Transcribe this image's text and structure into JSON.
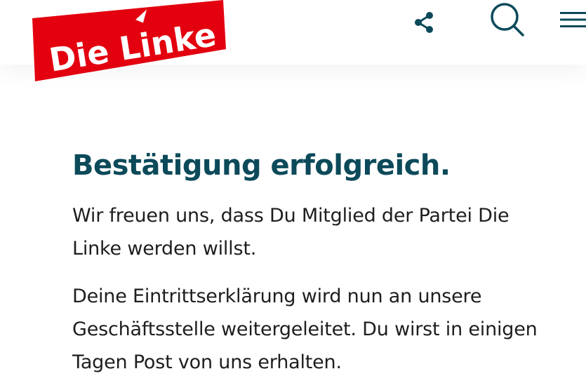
{
  "header": {
    "logo_text": "Die Linke",
    "share_icon": "share-icon",
    "search_icon": "search-icon",
    "menu_icon": "hamburger-menu-icon"
  },
  "main": {
    "title": "Bestätigung erfolgreich.",
    "paragraph_1": "Wir freuen uns, dass Du Mitglied der Partei Die Linke werden willst.",
    "paragraph_2": "Deine Eintrittserklärung wird nun an unsere Geschäftsstelle weitergeleitet. Du wirst in einigen Tagen Post von uns erhalten."
  },
  "colors": {
    "brand_red": "#e3000f",
    "title_teal": "#0c4a5a",
    "icon_teal": "#0c4a5a",
    "text": "#1e1e1e"
  }
}
